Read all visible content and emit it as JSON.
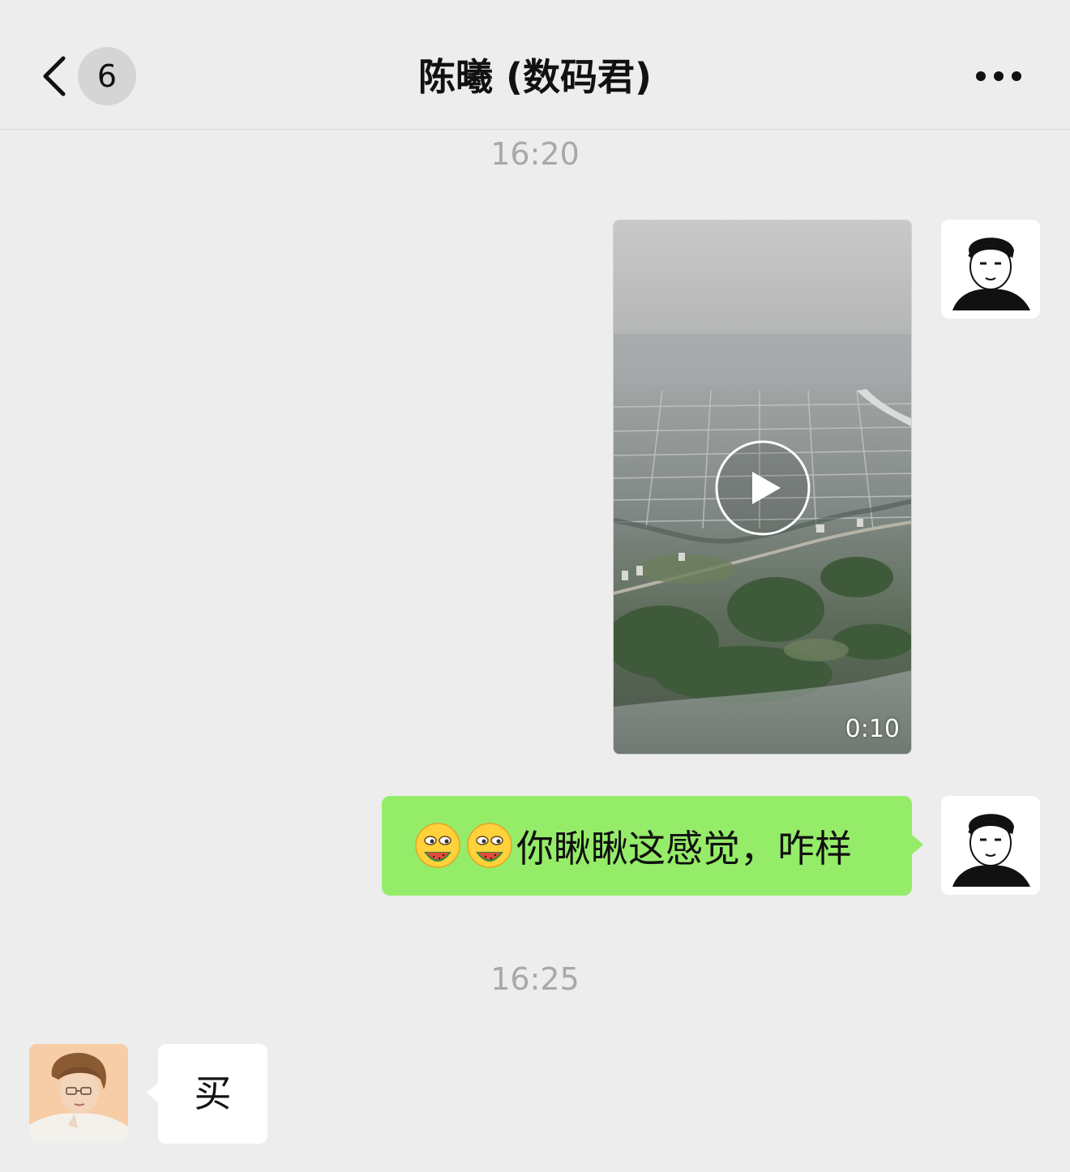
{
  "header": {
    "title": "陈曦 (数码君)",
    "unread_count": "6",
    "back_icon": "chevron-left-icon",
    "more_icon": "more-dots-icon"
  },
  "messages": [
    {
      "type": "timestamp",
      "text": "16:20"
    },
    {
      "type": "video",
      "sender": "me",
      "duration": "0:10",
      "icon": "play-icon"
    },
    {
      "type": "text",
      "sender": "me",
      "emoji": [
        "eating-watermelon-emoji",
        "eating-watermelon-emoji"
      ],
      "text": "你瞅瞅这感觉，咋样"
    },
    {
      "type": "timestamp",
      "text": "16:25"
    },
    {
      "type": "text",
      "sender": "contact",
      "text": "买"
    }
  ],
  "colors": {
    "background": "#ededed",
    "outgoing_bubble": "#95ec69",
    "incoming_bubble": "#ffffff",
    "timestamp": "#a8a8a8"
  }
}
